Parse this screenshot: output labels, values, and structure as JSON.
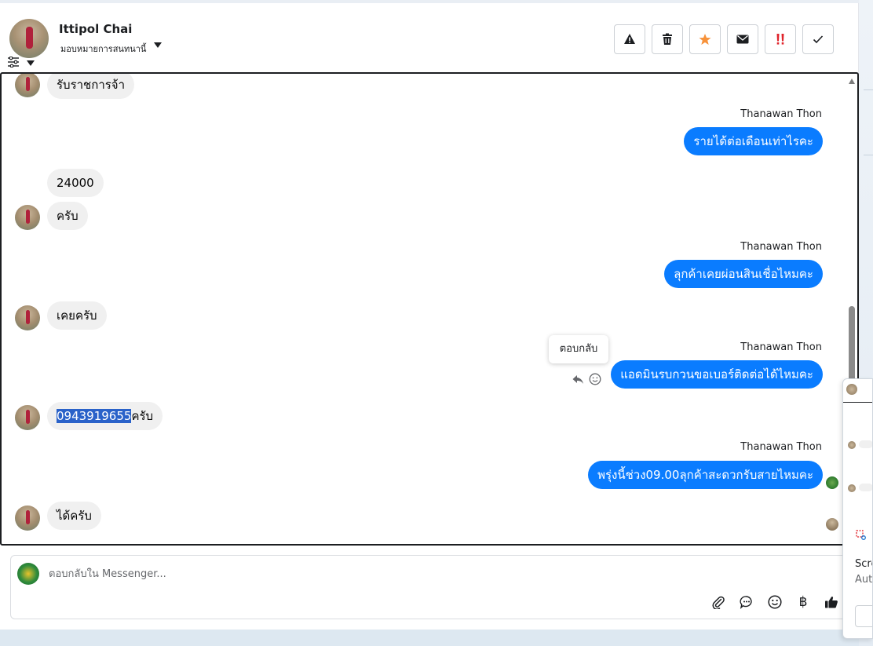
{
  "header": {
    "name": "Ittipol Chai",
    "assign_label": "มอบหมายการสนทนานี้",
    "actions": [
      {
        "name": "report-button",
        "icon": "warning-icon"
      },
      {
        "name": "delete-button",
        "icon": "trash-icon"
      },
      {
        "name": "star-button",
        "icon": "star-icon"
      },
      {
        "name": "mail-button",
        "icon": "envelope-icon"
      },
      {
        "name": "important-button",
        "icon": "double-exclamation-icon"
      },
      {
        "name": "done-button",
        "icon": "check-icon"
      }
    ]
  },
  "messages": [
    {
      "dir": "in",
      "text": "รับราชการจ้า"
    },
    {
      "dir": "out",
      "sender": "Thanawan Thon",
      "text": "รายได้ต่อเดือนเท่าไรคะ"
    },
    {
      "dir": "in",
      "text": "24000"
    },
    {
      "dir": "in",
      "text": "ครับ"
    },
    {
      "dir": "out",
      "sender": "Thanawan Thon",
      "text": "ลุกค้าเคยผ่อนสินเชื่อไหมคะ"
    },
    {
      "dir": "in",
      "text": "เคยครับ"
    },
    {
      "dir": "out",
      "sender": "Thanawan Thon",
      "text": "แอดมินรบกวนขอเบอร์ติดต่อได้ไหมคะ"
    },
    {
      "dir": "in",
      "text_highlight": "0943919655",
      "text_rest": "ครับ"
    },
    {
      "dir": "out",
      "sender": "Thanawan Thon",
      "text": "พรุ่งนี้ช่วง09.00ลุกค้าสะดวกรับสายไหมคะ"
    },
    {
      "dir": "in",
      "text": "ได้ครับ"
    }
  ],
  "tooltip": {
    "text": "ตอบกลับ"
  },
  "composer": {
    "placeholder": "ตอบกลับใน Messenger...",
    "tools": [
      "paperclip-icon",
      "chat-bubble-icon",
      "emoji-icon",
      "baht-icon",
      "thumbs-up-icon"
    ],
    "baht_symbol": "฿"
  },
  "mini_window": {
    "title_line": "Scre",
    "sub_line": "Auto"
  },
  "colors": {
    "accent": "#0a7cff",
    "incoming_bubble": "#f0f0f0",
    "highlight": "#2a62c9",
    "star": "#f7923a",
    "important": "#e0242b"
  }
}
